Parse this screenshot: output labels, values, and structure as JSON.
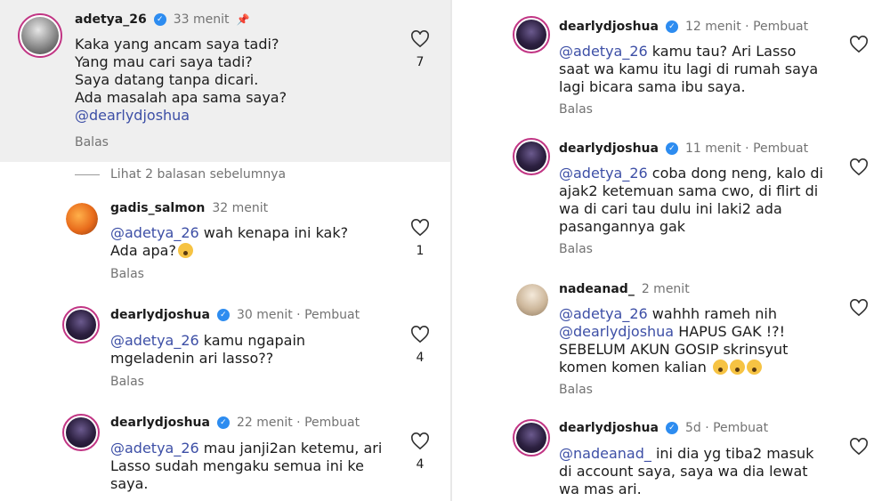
{
  "left": {
    "pinned": {
      "username": "adetya_26",
      "time": "33 menit",
      "lines": [
        "Kaka yang ancam saya tadi?",
        "Yang mau cari saya tadi?",
        "Saya datang tanpa dicari.",
        "Ada masalah apa sama saya?"
      ],
      "mention": "@dearlydjoshua",
      "reply": "Balas",
      "likes": "7"
    },
    "view_previous": "Lihat 2 balasan sebelumnya",
    "replies": [
      {
        "username": "gadis_salmon",
        "time": "32 menit",
        "mention": "@adetya_26",
        "text": " wah kenapa ini kak?\nAda apa?",
        "reply": "Balas",
        "likes": "1"
      },
      {
        "username": "dearlydjoshua",
        "time": "30 menit · Pembuat",
        "mention": "@adetya_26",
        "text": " kamu ngapain\nmgeladenin ari lasso??",
        "reply": "Balas",
        "likes": "4"
      },
      {
        "username": "dearlydjoshua",
        "time": "22 menit · Pembuat",
        "mention": "@adetya_26",
        "text": " mau janji2an ketemu, ari\nLasso sudah mengaku semua ini ke\nsaya.",
        "reply": "",
        "likes": "4"
      }
    ]
  },
  "right": {
    "replies": [
      {
        "username": "dearlydjoshua",
        "time": "12 menit · Pembuat",
        "mention": "@adetya_26",
        "text": " kamu tau? Ari Lasso\nsaat wa kamu itu lagi di rumah saya\nlagi bicara sama ibu saya.",
        "reply": "Balas"
      },
      {
        "username": "dearlydjoshua",
        "time": "11 menit · Pembuat",
        "mention": "@adetya_26",
        "text": " coba dong neng, kalo di\najak2 ketemuan sama cwo, di flirt di\nwa di cari tau dulu ini laki2 ada\npasangannya gak",
        "reply": "Balas"
      },
      {
        "username": "nadeanad_",
        "time": "2 menit",
        "mention": "@adetya_26",
        "text": " wahhh rameh nih",
        "mention2": "@dearlydjoshua",
        "text2": " HAPUS GAK !?!\nSEBELUM AKUN GOSIP skrinsyut\nkomen komen kalian",
        "reply": "Balas"
      },
      {
        "username": "dearlydjoshua",
        "time": "5d · Pembuat",
        "mention": "@nadeanad_",
        "text": " ini dia yg tiba2 masuk\ndi account saya, saya wa dia lewat\nwa mas ari.",
        "reply": ""
      }
    ]
  }
}
